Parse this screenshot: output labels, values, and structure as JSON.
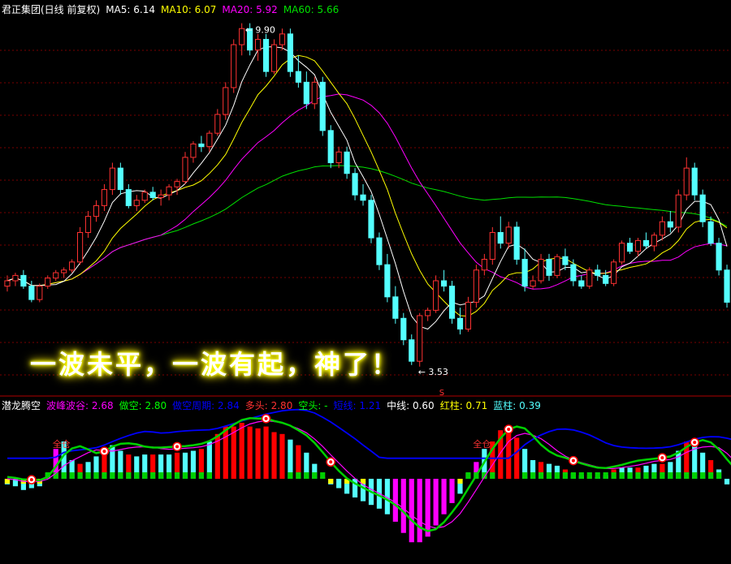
{
  "header": {
    "title": "君正集团(日线 前复权)",
    "ma5": "MA5: 6.14",
    "ma10": "MA10: 6.07",
    "ma20": "MA20: 5.92",
    "ma60": "MA60: 5.66"
  },
  "caption": "一波未平，一波有起，神了！",
  "annotations": {
    "high_label": "9.90",
    "low_label": "3.53",
    "marker": "S",
    "full_pos": "全仓"
  },
  "indicator_header": {
    "name": "潜龙腾空",
    "i1": "波峰波谷: 2.68",
    "i2": "做空: 2.80",
    "i3": "做空周期: 2.84",
    "i4": "多头: 2.80",
    "i5": "空头: -",
    "i6": "短线: 1.21",
    "i7": "中线: 0.60",
    "i8": "红柱: 0.71",
    "i9": "蓝柱: 0.39"
  },
  "colors": {
    "up": "#ff3232",
    "down": "#54ffff",
    "ma5": "#ffffff",
    "ma10": "#ffff00",
    "ma20": "#ff00ff",
    "ma60": "#00e000",
    "grid": "#7a0000",
    "bar_red": "#ff0000",
    "bar_cyan": "#54ffff",
    "bar_magenta": "#ff00ff",
    "bar_yellow": "#ffff00",
    "bar_green": "#00d000",
    "line_blue": "#0000ff"
  },
  "chart_data": {
    "type": "candlestick",
    "price_axis": {
      "min": 3.53,
      "max": 9.9
    },
    "candles": [
      [
        5.0,
        5.2,
        4.9,
        5.1
      ],
      [
        5.1,
        5.25,
        5.0,
        5.2
      ],
      [
        5.2,
        5.3,
        4.95,
        5.0
      ],
      [
        5.0,
        5.1,
        4.7,
        4.75
      ],
      [
        4.75,
        5.05,
        4.7,
        5.0
      ],
      [
        5.0,
        5.2,
        4.95,
        5.15
      ],
      [
        5.15,
        5.3,
        5.1,
        5.25
      ],
      [
        5.25,
        5.35,
        5.15,
        5.3
      ],
      [
        5.3,
        5.5,
        5.25,
        5.45
      ],
      [
        5.45,
        6.1,
        5.4,
        6.0
      ],
      [
        6.0,
        6.4,
        5.9,
        6.3
      ],
      [
        6.3,
        6.6,
        6.2,
        6.5
      ],
      [
        6.5,
        6.9,
        6.4,
        6.8
      ],
      [
        6.8,
        7.3,
        6.7,
        7.2
      ],
      [
        7.2,
        7.3,
        6.7,
        6.8
      ],
      [
        6.8,
        6.9,
        6.45,
        6.5
      ],
      [
        6.5,
        6.7,
        6.4,
        6.6
      ],
      [
        6.6,
        6.8,
        6.55,
        6.75
      ],
      [
        6.75,
        6.85,
        6.6,
        6.65
      ],
      [
        6.65,
        6.8,
        6.5,
        6.7
      ],
      [
        6.7,
        6.9,
        6.6,
        6.85
      ],
      [
        6.85,
        7.0,
        6.7,
        6.95
      ],
      [
        6.95,
        7.5,
        6.9,
        7.4
      ],
      [
        7.4,
        7.7,
        7.3,
        7.65
      ],
      [
        7.65,
        7.8,
        7.5,
        7.6
      ],
      [
        7.6,
        7.9,
        7.5,
        7.85
      ],
      [
        7.85,
        8.3,
        7.8,
        8.2
      ],
      [
        8.2,
        8.8,
        8.1,
        8.7
      ],
      [
        8.7,
        9.6,
        8.6,
        9.5
      ],
      [
        9.5,
        9.9,
        9.3,
        9.8
      ],
      [
        9.8,
        9.9,
        9.3,
        9.4
      ],
      [
        9.4,
        9.7,
        9.2,
        9.6
      ],
      [
        9.6,
        9.7,
        8.9,
        9.0
      ],
      [
        9.0,
        9.6,
        8.95,
        9.5
      ],
      [
        9.5,
        9.8,
        9.4,
        9.7
      ],
      [
        9.7,
        9.8,
        8.9,
        9.0
      ],
      [
        9.0,
        9.3,
        8.7,
        8.8
      ],
      [
        8.8,
        9.0,
        8.3,
        8.4
      ],
      [
        8.4,
        8.9,
        8.3,
        8.8
      ],
      [
        8.8,
        8.9,
        7.8,
        7.9
      ],
      [
        7.9,
        8.0,
        7.2,
        7.3
      ],
      [
        7.3,
        7.6,
        7.2,
        7.5
      ],
      [
        7.5,
        7.6,
        7.0,
        7.1
      ],
      [
        7.1,
        7.2,
        6.6,
        6.7
      ],
      [
        6.7,
        6.9,
        6.5,
        6.6
      ],
      [
        6.6,
        6.7,
        5.8,
        5.9
      ],
      [
        5.9,
        6.0,
        5.3,
        5.4
      ],
      [
        5.4,
        5.6,
        4.7,
        4.8
      ],
      [
        4.8,
        5.0,
        4.3,
        4.4
      ],
      [
        4.4,
        4.5,
        3.9,
        4.0
      ],
      [
        4.0,
        4.1,
        3.53,
        3.6
      ],
      [
        3.6,
        4.5,
        3.5,
        4.45
      ],
      [
        4.45,
        4.6,
        4.35,
        4.55
      ],
      [
        4.55,
        5.2,
        4.5,
        5.1
      ],
      [
        5.1,
        5.3,
        4.9,
        5.0
      ],
      [
        5.0,
        5.1,
        4.3,
        4.4
      ],
      [
        4.4,
        4.6,
        4.1,
        4.2
      ],
      [
        4.2,
        4.8,
        4.15,
        4.7
      ],
      [
        4.7,
        5.4,
        4.6,
        5.3
      ],
      [
        5.3,
        5.6,
        5.2,
        5.5
      ],
      [
        5.5,
        6.1,
        5.4,
        6.0
      ],
      [
        6.0,
        6.3,
        5.7,
        5.8
      ],
      [
        5.8,
        6.2,
        5.7,
        6.1
      ],
      [
        6.1,
        6.2,
        5.4,
        5.5
      ],
      [
        5.5,
        5.7,
        4.9,
        5.0
      ],
      [
        5.0,
        5.2,
        4.95,
        5.1
      ],
      [
        5.1,
        5.6,
        5.05,
        5.5
      ],
      [
        5.5,
        5.6,
        5.1,
        5.2
      ],
      [
        5.2,
        5.6,
        5.15,
        5.55
      ],
      [
        5.55,
        5.7,
        5.3,
        5.4
      ],
      [
        5.4,
        5.5,
        5.0,
        5.1
      ],
      [
        5.1,
        5.2,
        4.95,
        5.0
      ],
      [
        5.0,
        5.35,
        4.95,
        5.3
      ],
      [
        5.3,
        5.4,
        5.1,
        5.2
      ],
      [
        5.2,
        5.3,
        5.0,
        5.05
      ],
      [
        5.05,
        5.5,
        5.0,
        5.45
      ],
      [
        5.45,
        5.85,
        5.4,
        5.8
      ],
      [
        5.8,
        5.9,
        5.6,
        5.65
      ],
      [
        5.65,
        5.9,
        5.55,
        5.85
      ],
      [
        5.85,
        6.0,
        5.7,
        5.75
      ],
      [
        5.75,
        6.0,
        5.65,
        5.95
      ],
      [
        5.95,
        6.3,
        5.85,
        6.2
      ],
      [
        6.2,
        6.4,
        6.0,
        6.1
      ],
      [
        6.1,
        6.8,
        6.0,
        6.7
      ],
      [
        6.7,
        7.4,
        6.6,
        7.2
      ],
      [
        7.2,
        7.3,
        6.6,
        6.7
      ],
      [
        6.7,
        6.8,
        6.1,
        6.2
      ],
      [
        6.2,
        6.3,
        5.75,
        5.8
      ],
      [
        5.8,
        5.9,
        5.2,
        5.3
      ],
      [
        5.3,
        5.4,
        4.6,
        4.7
      ]
    ],
    "indicator": {
      "bars": [
        -0.3,
        -0.4,
        -0.6,
        -0.5,
        -0.4,
        0.3,
        1.6,
        2.0,
        1.0,
        0.8,
        0.9,
        1.2,
        1.4,
        1.8,
        1.5,
        1.3,
        1.2,
        1.3,
        1.3,
        1.3,
        1.3,
        1.4,
        1.4,
        1.5,
        1.6,
        2.0,
        2.4,
        2.8,
        2.8,
        3.0,
        2.8,
        2.7,
        2.8,
        2.5,
        2.4,
        2.1,
        1.8,
        1.4,
        0.8,
        0.1,
        -0.3,
        -0.5,
        -0.8,
        -1.0,
        -1.2,
        -1.4,
        -1.6,
        -1.9,
        -2.3,
        -2.9,
        -3.4,
        -3.4,
        -3.1,
        -2.5,
        -1.9,
        -1.3,
        -0.8,
        0.3,
        0.9,
        1.6,
        2.0,
        2.6,
        2.8,
        2.2,
        1.6,
        1.0,
        0.9,
        0.8,
        0.7,
        0.5,
        0.3,
        0.2,
        0.2,
        0.1,
        0.2,
        0.5,
        0.6,
        0.6,
        0.6,
        0.7,
        0.8,
        0.8,
        0.9,
        1.5,
        2.0,
        1.8,
        1.4,
        1.0,
        0.5,
        -0.3,
        -0.6
      ]
    }
  }
}
